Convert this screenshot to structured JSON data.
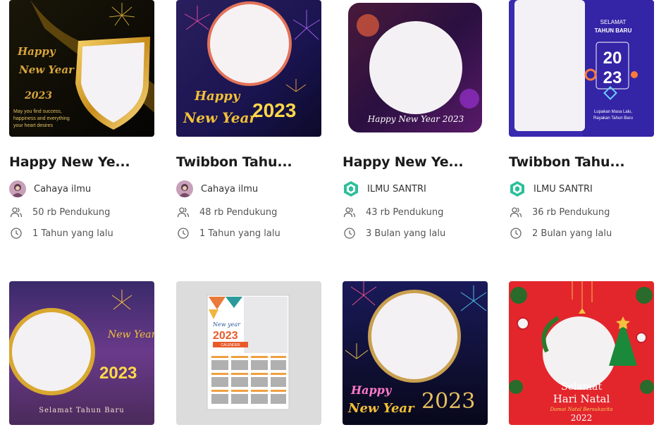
{
  "cards": [
    {
      "title": "Happy New Ye...",
      "author": "Cahaya ilmu",
      "supporters": "50 rb Pendukung",
      "time": "1 Tahun yang lalu",
      "thumb_texts": [
        "Happy",
        "New Year",
        "2023",
        "May you find success,",
        "happiness and everything",
        "your heart desires"
      ]
    },
    {
      "title": "Twibbon Tahu...",
      "author": "Cahaya ilmu",
      "supporters": "48 rb Pendukung",
      "time": "1 Tahun yang lalu",
      "thumb_texts": [
        "Happy",
        "New Year",
        "2023"
      ]
    },
    {
      "title": "Happy New Ye...",
      "author": "ILMU SANTRI",
      "supporters": "43 rb Pendukung",
      "time": "3 Bulan yang lalu",
      "thumb_texts": [
        "Happy New Year 2023"
      ]
    },
    {
      "title": "Twibbon Tahu...",
      "author": "ILMU SANTRI",
      "supporters": "36 rb Pendukung",
      "time": "2 Bulan yang lalu",
      "thumb_texts": [
        "SELAMAT",
        "TAHUN BARU",
        "20",
        "23",
        "Lupakan Masa Lalu,",
        "Rayakan Tahun Baru"
      ]
    },
    {
      "thumb_texts": [
        "New Year",
        "2023",
        "Selamat Tahun Baru"
      ]
    },
    {
      "thumb_texts": [
        "New year",
        "2023",
        "CALENDER"
      ]
    },
    {
      "thumb_texts": [
        "Happy",
        "New Year",
        "2023"
      ]
    },
    {
      "thumb_texts": [
        "Selamat",
        "Hari Natal",
        "Damai Natal Bersukacita",
        "2022"
      ]
    }
  ],
  "icons": {
    "supporters": "users-icon",
    "time": "clock-icon",
    "author_cahaya": "avatar-photo",
    "author_santri": "ilmu-santri-logo"
  },
  "colors": {
    "title": "#1b1b1b",
    "meta_text": "#555555",
    "santri_logo": "#2bbf9a"
  }
}
